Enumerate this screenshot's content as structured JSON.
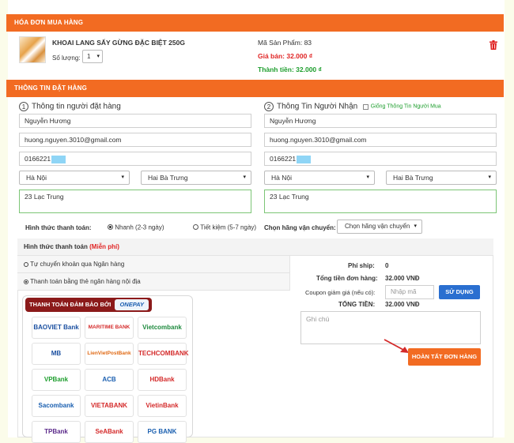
{
  "invoice": {
    "header": "HÓA ĐƠN MUA HÀNG",
    "product_name": "KHOAI LANG SẤY GỪNG ĐẶC BIỆT 250G",
    "qty_label": "Số lượng:",
    "qty_value": "1",
    "code_label": "Mã Sản Phẩm: 83",
    "price_label": "Giá bán: 32.000 ₫",
    "total_label": "Thành tiền: 32.000 ₫"
  },
  "order": {
    "header": "THÔNG TIN ĐẶT HÀNG",
    "buyer": {
      "step": "1",
      "title": "Thông tin người đặt hàng",
      "name": "Nguyễn Hương",
      "email": "huong.nguyen.3010@gmail.com",
      "phone": "0166221",
      "city": "Hà Nội",
      "district": "Hai Bà Trưng",
      "address": "23 Lạc Trung"
    },
    "receiver": {
      "step": "2",
      "title": "Thông Tin Người Nhận",
      "same_label": "Giống Thông Tin Người Mua",
      "name": "Nguyễn Hương",
      "email": "huong.nguyen.3010@gmail.com",
      "phone": "0166221",
      "city": "Hà Nội",
      "district": "Hai Bà Trưng",
      "address": "23 Lạc Trung"
    },
    "ship_method_label": "Hình thức thanh toán:",
    "opt_fast": "Nhanh (2-3 ngày)",
    "opt_save": "Tiết kiệm (5-7 ngày)",
    "carrier_label": "Chọn hãng vận chuyển:",
    "carrier_value": "Chọn hãng vận chuyển"
  },
  "payment": {
    "title": "Hình thức thanh toán",
    "free": "(Miễn phí)",
    "opt_transfer": "Tự chuyển khoản qua Ngân hàng",
    "opt_card": "Thanh toán bằng thẻ ngân hàng nội địa",
    "badge_text": "THANH TOÁN ĐẢM BẢO BỞI",
    "badge_brand": "ONEPAY",
    "banks": [
      "BAOVIET Bank",
      "MARITIME BANK",
      "Vietcombank",
      "MB",
      "LienVietPostBank",
      "TECHCOMBANK",
      "VPBank",
      "ACB",
      "HDBank",
      "Sacombank",
      "VIETABANK",
      "VietinBank",
      "TPBank",
      "SeABank",
      "PG BANK"
    ]
  },
  "summary": {
    "ship_label": "Phí ship:",
    "ship_value": "0",
    "subtotal_label": "Tổng tiền đơn hàng:",
    "subtotal_value": "32.000 VNĐ",
    "coupon_label": "Coupon giảm giá (nếu có):",
    "coupon_placeholder": "Nhập mã",
    "apply_label": "SỬ DỤNG",
    "total_label": "TỔNG TIỀN:",
    "total_value": "32.000 VNĐ",
    "note_placeholder": "Ghi chú",
    "finish_label": "HOÀN TẤT ĐƠN HÀNG"
  },
  "colors": {
    "accent": "#f26b22",
    "blue": "#2a6fd0",
    "red": "#e02424",
    "green": "#1e9e2e"
  }
}
